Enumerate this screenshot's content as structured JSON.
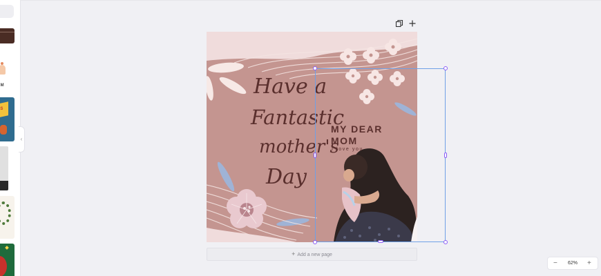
{
  "canvas": {
    "card": {
      "greeting_lines": [
        "Have a",
        "Fantastic",
        "mother's",
        "Day"
      ],
      "heading_lines": [
        "MY DEAR",
        "MOM"
      ],
      "subtext": "I love you"
    },
    "add_page_label": "Add a new page"
  },
  "left_panel": {
    "partial_label": "UM"
  },
  "zoom": {
    "value": "62%"
  },
  "colors": {
    "page_background": "#c49590",
    "text_brown": "#5a2f2d",
    "selection_blue": "#6fa0e6",
    "handle_purple": "#8b5cf6"
  },
  "icons": [
    "copy-icon",
    "plus-icon",
    "rotate-icon",
    "minus-icon",
    "chevron-left-icon"
  ]
}
